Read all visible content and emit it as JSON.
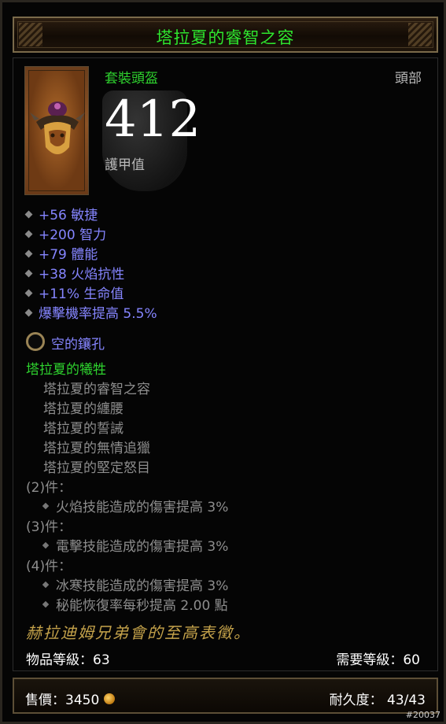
{
  "item": {
    "name": "塔拉夏的睿智之容",
    "type": "套裝頭盔",
    "slot": "頭部",
    "armor_value": "412",
    "armor_label": "護甲值"
  },
  "stats": [
    "+56 敏捷",
    "+200 智力",
    "+79 體能",
    "+38 火焰抗性",
    "+11% 生命值",
    "爆擊機率提高 5.5%"
  ],
  "socket_label": "空的鑲孔",
  "set": {
    "name": "塔拉夏的犧牲",
    "pieces": [
      "塔拉夏的睿智之容",
      "塔拉夏的纏腰",
      "塔拉夏的誓誡",
      "塔拉夏的無情追獵",
      "塔拉夏的堅定怒目"
    ],
    "bonus_2_head": "(2)件：",
    "bonus_2": [
      "火焰技能造成的傷害提高 3%"
    ],
    "bonus_3_head": "(3)件：",
    "bonus_3": [
      "電擊技能造成的傷害提高 3%"
    ],
    "bonus_4_head": "(4)件：",
    "bonus_4": [
      "冰寒技能造成的傷害提高 3%",
      "秘能恢復率每秒提高 2.00 點"
    ]
  },
  "flavor_text": "赫拉迪姆兄弟會的至高表徵。",
  "item_level": "物品等級：63",
  "required_level": "需要等級：60",
  "sell_price": "售價：3450",
  "durability": "耐久度： 43/43",
  "tag_id": "#20037",
  "colors": {
    "set_green": "#2ed22e",
    "magic_blue": "#8585ff",
    "flavor_gold": "#c4a24a"
  },
  "icons": [
    "helm-icon",
    "shield-icon",
    "socket-icon",
    "gold-coin-icon",
    "diamond-bullet-icon"
  ]
}
